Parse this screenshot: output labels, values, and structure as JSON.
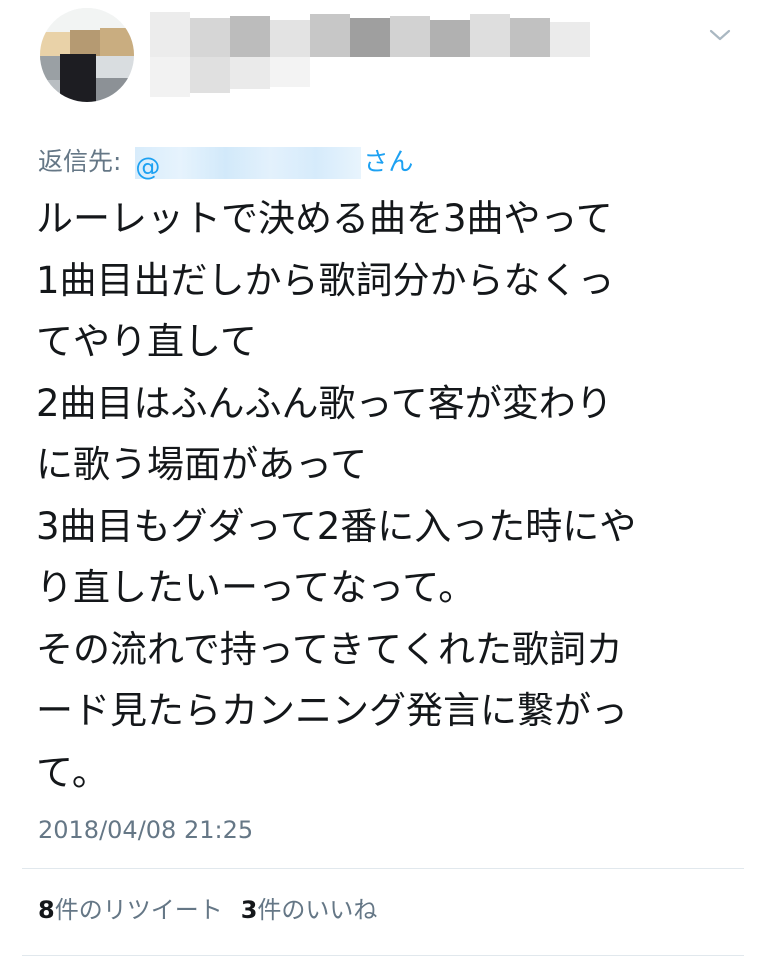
{
  "header": {
    "menu_icon": "chevron-down-icon"
  },
  "reply": {
    "label": "返信先:",
    "mention_prefix": "@",
    "mention_suffix": "さん"
  },
  "tweet": {
    "lines": [
      "ルーレットで決める曲を3曲やって",
      "1曲目出だしから歌詞分からなくっ",
      "てやり直して",
      "2曲目はふんふん歌って客が変わり",
      "に歌う場面があって",
      "3曲目もグダって2番に入った時にや",
      "り直したいーってなって。",
      "その流れで持ってきてくれた歌詞カ",
      "ード見たらカンニング発言に繋がっ",
      "て。"
    ]
  },
  "timestamp": "2018/04/08 21:25",
  "stats": {
    "retweets_count": "8",
    "retweets_label": "件のリツイート",
    "likes_count": "3",
    "likes_label": "件のいいね"
  },
  "colors": {
    "text": "#14171a",
    "secondary": "#657786",
    "link": "#1da1f2",
    "divider": "#e1e8ed"
  }
}
